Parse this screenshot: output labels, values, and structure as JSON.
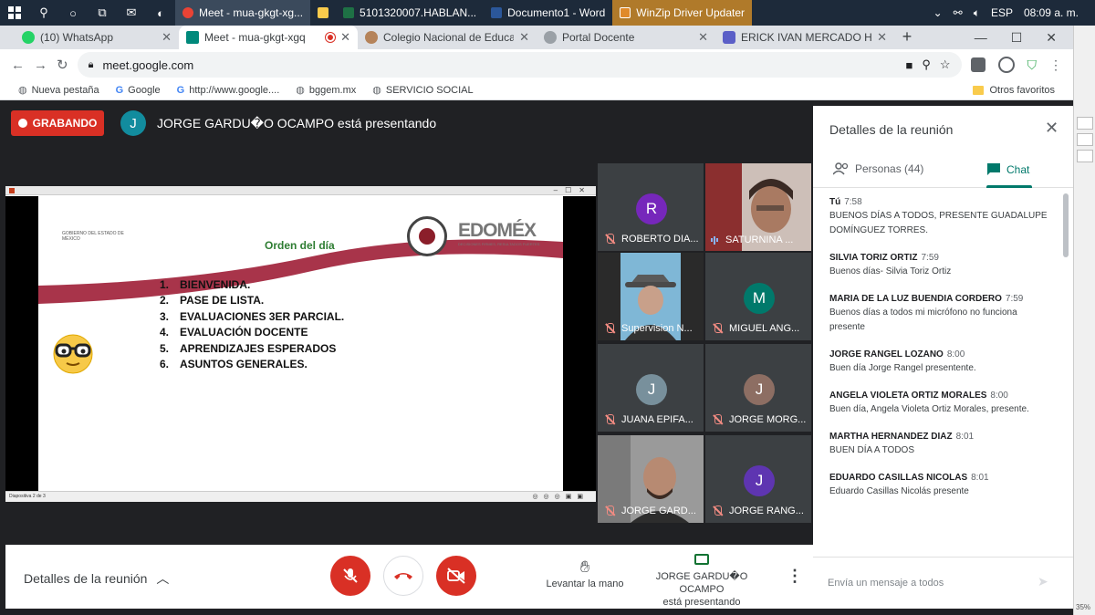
{
  "taskbar": {
    "apps": [
      {
        "label": "Meet - mua-gkgt-xg...",
        "color": "#ea4335",
        "active": true
      },
      {
        "label": "",
        "color": "#f9cb4c"
      },
      {
        "label": "5101320007.HABLAN...",
        "color": "#1e7145"
      },
      {
        "label": "Documento1 - Word",
        "color": "#2b579a"
      },
      {
        "label": "WinZip Driver Updater",
        "color": "#e08a2a"
      }
    ],
    "lang": "ESP",
    "clock": "08:09 a. m."
  },
  "tabs": [
    {
      "title": "(10) WhatsApp",
      "color": "#25d366",
      "active": false
    },
    {
      "title": "Meet - mua-gkgt-xgq",
      "color": "#00897b",
      "active": true
    },
    {
      "title": "Colegio Nacional de Educació",
      "color": "#b5835a",
      "active": false
    },
    {
      "title": "Portal Docente",
      "color": "#9aa0a6",
      "active": false
    },
    {
      "title": "ERICK IVAN MERCADO HERN",
      "color": "#5b5fc7",
      "active": false
    }
  ],
  "address": {
    "url": "meet.google.com"
  },
  "bookmarks": {
    "items": [
      "Nueva pestaña",
      "Google",
      "http://www.google....",
      "bggem.mx",
      "SERVICIO SOCIAL"
    ],
    "other": "Otros favoritos"
  },
  "meet": {
    "recording_label": "GRABANDO",
    "presenter_initial": "J",
    "presenter_text": "JORGE GARDU�O OCAMPO está presentando"
  },
  "slide": {
    "gob_text": "GOBIERNO DEL ESTADO DE MÉXICO",
    "brand": "EDOMÉX",
    "brand_sub": "DECISIONES FIRMES, RESULTADOS FUERTES.",
    "title": "Orden del día",
    "agenda": [
      {
        "n": "1.",
        "text": "BIENVENIDA."
      },
      {
        "n": "2.",
        "text": "PASE DE LISTA."
      },
      {
        "n": "3.",
        "text": "EVALUACIONES 3ER PARCIAL."
      },
      {
        "n": "4.",
        "text": "EVALUACIÓN DOCENTE"
      },
      {
        "n": "5.",
        "text": "APRENDIZAJES ESPERADOS"
      },
      {
        "n": "6.",
        "text": "ASUNTOS GENERALES."
      }
    ],
    "status": "Diapositiva 2 de 3"
  },
  "participants": [
    {
      "name": "ROBERTO DIA...",
      "initial": "R",
      "color": "#7627bb",
      "video": false,
      "speaking": false
    },
    {
      "name": "SATURNINA ...",
      "initial": "",
      "color": "",
      "video": true,
      "speaking": true
    },
    {
      "name": "Supervision N...",
      "initial": "",
      "color": "",
      "video": true,
      "speaking": false
    },
    {
      "name": "MIGUEL ANG...",
      "initial": "M",
      "color": "#00796b",
      "video": false,
      "speaking": false
    },
    {
      "name": "JUANA EPIFA...",
      "initial": "J",
      "color": "#78909c",
      "video": false,
      "speaking": false
    },
    {
      "name": "JORGE MORG...",
      "initial": "J",
      "color": "#8d6e63",
      "video": false,
      "speaking": false
    },
    {
      "name": "JORGE GARD...",
      "initial": "",
      "color": "",
      "video": true,
      "speaking": false
    },
    {
      "name": "JORGE RANG...",
      "initial": "J",
      "color": "#5e35b1",
      "video": false,
      "speaking": false
    }
  ],
  "bottombar": {
    "details_label": "Detalles de la reunión",
    "raise_hand": "Levantar la mano",
    "presenting_line1": "JORGE GARDU�O OCAMPO",
    "presenting_line2": "está presentando"
  },
  "panel": {
    "title": "Detalles de la reunión",
    "people_tab": "Personas (44)",
    "chat_tab": "Chat",
    "messages": [
      {
        "who": "Tú",
        "time": "7:58",
        "text": "BUENOS DÍAS A TODOS, PRESENTE GUADALUPE DOMÍNGUEZ TORRES."
      },
      {
        "who": "SILVIA TORIZ ORTIZ",
        "time": "7:59",
        "text": "Buenos días- Silvia Toriz Ortiz"
      },
      {
        "who": "MARIA DE LA LUZ BUENDIA CORDERO",
        "time": "7:59",
        "text": "Buenos días a todos mi micrófono no funciona presente"
      },
      {
        "who": "JORGE RANGEL LOZANO",
        "time": "8:00",
        "text": "Buen día Jorge Rangel presentente."
      },
      {
        "who": "ANGELA VIOLETA ORTIZ MORALES",
        "time": "8:00",
        "text": "Buen día, Angela Violeta Ortiz Morales, presente."
      },
      {
        "who": "MARTHA HERNANDEZ DIAZ",
        "time": "8:01",
        "text": "BUEN DÍA A TODOS"
      },
      {
        "who": "EDUARDO CASILLAS NICOLAS",
        "time": "8:01",
        "text": "Eduardo Casillas Nicolás presente"
      }
    ],
    "input_placeholder": "Envía un mensaje a todos"
  },
  "side_strip": {
    "zoom": "35%"
  },
  "colors": {
    "accent": "#00796b",
    "danger": "#d93025"
  }
}
